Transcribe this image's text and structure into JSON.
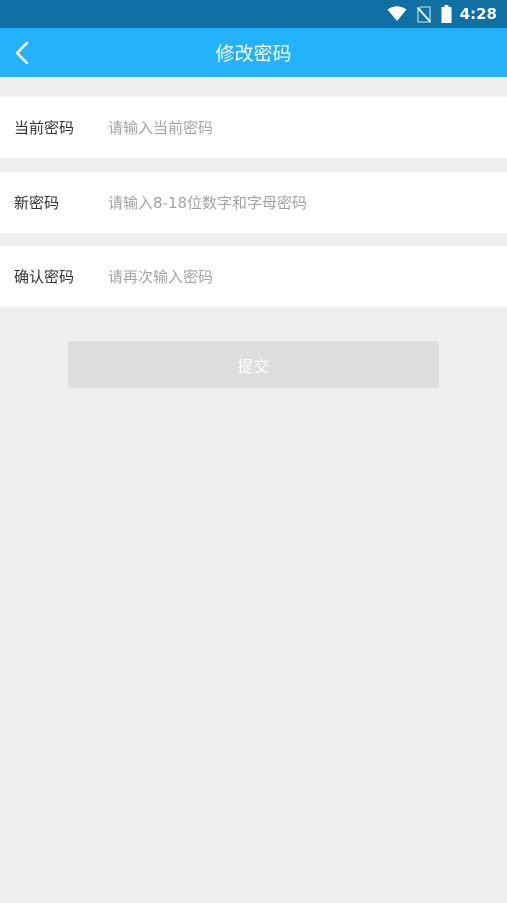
{
  "status_bar": {
    "time": "4:28",
    "icons": [
      "wifi-icon",
      "no-sim-icon",
      "battery-icon"
    ]
  },
  "header": {
    "title": "修改密码",
    "back_icon": "chevron-left-icon"
  },
  "form": {
    "current_password": {
      "label": "当前密码",
      "placeholder": "请输入当前密码",
      "value": ""
    },
    "new_password": {
      "label": "新密码",
      "placeholder": "请输入8-18位数字和字母密码",
      "value": ""
    },
    "confirm_password": {
      "label": "确认密码",
      "placeholder": "请再次输入密码",
      "value": ""
    }
  },
  "submit": {
    "label": "提交"
  },
  "colors": {
    "status_bar": "#0f71a3",
    "app_bar": "#23b2fb",
    "background": "#efefef",
    "button_disabled": "#dddddd"
  }
}
